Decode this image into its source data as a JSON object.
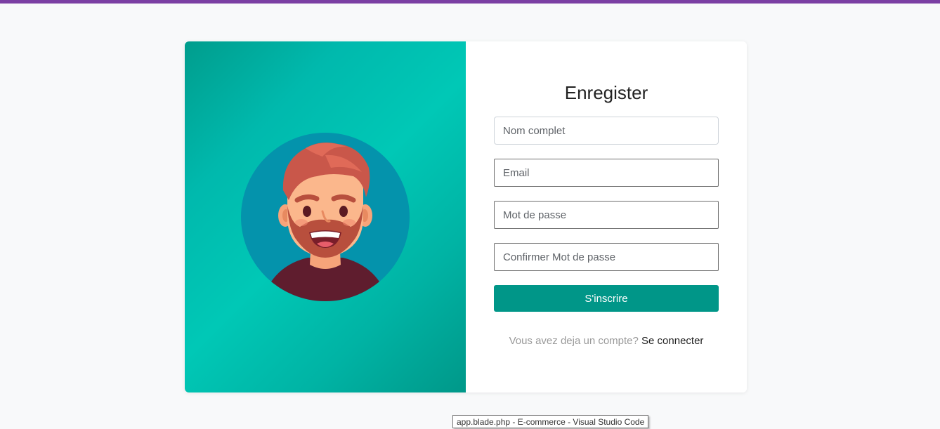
{
  "colors": {
    "top_bar": "#7b3fa3",
    "accent_button": "#009688",
    "panel_gradient_start": "#009d8d",
    "panel_gradient_mid": "#00c8b6"
  },
  "illustration": {
    "icon": "user-avatar-illustration"
  },
  "form": {
    "title": "Enregister",
    "fields": {
      "full_name_placeholder": "Nom complet",
      "email_placeholder": "Email",
      "password_placeholder": "Mot de passe",
      "confirm_password_placeholder": "Confirmer Mot de passe"
    },
    "submit_label": "S'inscrire",
    "login_prompt": "Vous avez deja un compte?",
    "login_link": "Se connecter"
  },
  "taskbar_tooltip": "app.blade.php - E-commerce - Visual Studio Code"
}
